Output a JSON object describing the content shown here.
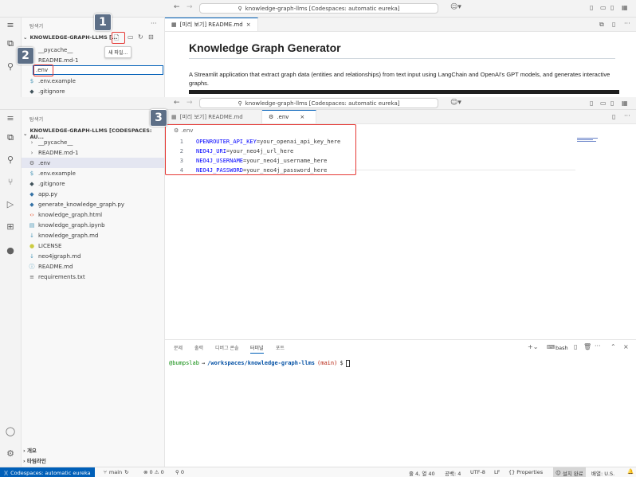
{
  "top_window": {
    "command_center": "knowledge-graph-llms [Codespaces: automatic eureka]",
    "sidebar_title": "탐색기",
    "section_title": "KNOWLEDGE-GRAPH-LLMS [...",
    "tooltip_new_file": "새 파일...",
    "tree": [
      {
        "name": "__pycache__",
        "icon": "chevron-right-icon"
      },
      {
        "name": "README.md-1",
        "icon": "chevron-right-icon"
      },
      {
        "name": ".env",
        "icon": "rename-input"
      },
      {
        "name": ".env.example",
        "icon": "dollar-icon"
      },
      {
        "name": ".gitignore",
        "icon": "diamond-icon"
      }
    ],
    "tab_label": "[미리 보기] README.md",
    "preview_heading": "Knowledge Graph Generator",
    "preview_paragraph": "A Streamlit application that extract graph data (entities and relationships) from text input using LangChain and OpenAI's GPT models, and generates interactive graphs."
  },
  "bottom_window": {
    "command_center": "knowledge-graph-llms [Codespaces: automatic eureka]",
    "sidebar_title": "탐색기",
    "section_title": "KNOWLEDGE-GRAPH-LLMS [CODESPACES: AU...",
    "tree": [
      {
        "name": "__pycache__",
        "icon": "chevron-right-icon",
        "glyph": "›",
        "color": "#616161"
      },
      {
        "name": "README.md-1",
        "icon": "chevron-right-icon",
        "glyph": "›",
        "color": "#616161"
      },
      {
        "name": ".env",
        "icon": "gear-icon",
        "glyph": "⚙",
        "color": "#616161",
        "selected": true
      },
      {
        "name": ".env.example",
        "icon": "dollar-icon",
        "glyph": "$",
        "color": "#519aba"
      },
      {
        "name": ".gitignore",
        "icon": "diamond-icon",
        "glyph": "◆",
        "color": "#41535b"
      },
      {
        "name": "app.py",
        "icon": "python-icon",
        "glyph": "◆",
        "color": "#3572a5"
      },
      {
        "name": "generate_knowledge_graph.py",
        "icon": "python-icon",
        "glyph": "◆",
        "color": "#3572a5"
      },
      {
        "name": "knowledge_graph.html",
        "icon": "html-icon",
        "glyph": "‹›",
        "color": "#e44d26"
      },
      {
        "name": "knowledge_graph.ipynb",
        "icon": "notebook-icon",
        "glyph": "▤",
        "color": "#519aba"
      },
      {
        "name": "knowledge_graph.md",
        "icon": "markdown-icon",
        "glyph": "↓",
        "color": "#519aba"
      },
      {
        "name": "LICENSE",
        "icon": "license-icon",
        "glyph": "●",
        "color": "#cbcb41"
      },
      {
        "name": "neo4jgraph.md",
        "icon": "markdown-icon",
        "glyph": "↓",
        "color": "#519aba"
      },
      {
        "name": "README.md",
        "icon": "info-icon",
        "glyph": "ⓘ",
        "color": "#519aba"
      },
      {
        "name": "requirements.txt",
        "icon": "text-file-icon",
        "glyph": "≡",
        "color": "#616161"
      }
    ],
    "tabs": [
      {
        "label": "[미리 보기] README.md"
      },
      {
        "label": ".env"
      }
    ],
    "breadcrumb": ".env",
    "code_lines": [
      {
        "num": "1",
        "key": "OPENROUTER_API_KEY",
        "value": "=your_openai_api_key_here"
      },
      {
        "num": "2",
        "key": "NEO4J_URI",
        "value": "=your_neo4j_url_here"
      },
      {
        "num": "3",
        "key": "NEO4J_USERNAME",
        "value": "=your_neo4j_username_here"
      },
      {
        "num": "4",
        "key": "NEO4J_PASSWORD",
        "value": "=your_neo4j_password_here"
      }
    ],
    "panel_tabs": [
      "문제",
      "출력",
      "디버그 콘솔",
      "터미널",
      "포트"
    ],
    "terminal_shell": "bash",
    "terminal_prompt": {
      "user": "@bumpslab",
      "arrow": "→",
      "path": "/workspaces/knowledge-graph-llms",
      "branch": "(main)",
      "suffix": "$"
    },
    "outline_label": "개요",
    "timeline_label": "타임라인"
  },
  "status_bar": {
    "remote": "Codespaces: automatic eureka",
    "branch": "main",
    "problems": "⊗ 0 ⚠ 0",
    "ports": "⚲ 0",
    "position": "줄 4, 열 40",
    "spaces": "공백: 4",
    "encoding": "UTF-8",
    "eol": "LF",
    "language": "Properties",
    "install": "설치 완료",
    "layout": "배열: U.S."
  },
  "annotations": {
    "badge_1": "1",
    "badge_2": "2",
    "badge_3": "3",
    "rename_value": ".env"
  },
  "colors": {
    "accent": "#005fb8",
    "highlight_box": "#e53935",
    "badge_bg": "#5d6f87",
    "env_key": "#0000ff"
  }
}
